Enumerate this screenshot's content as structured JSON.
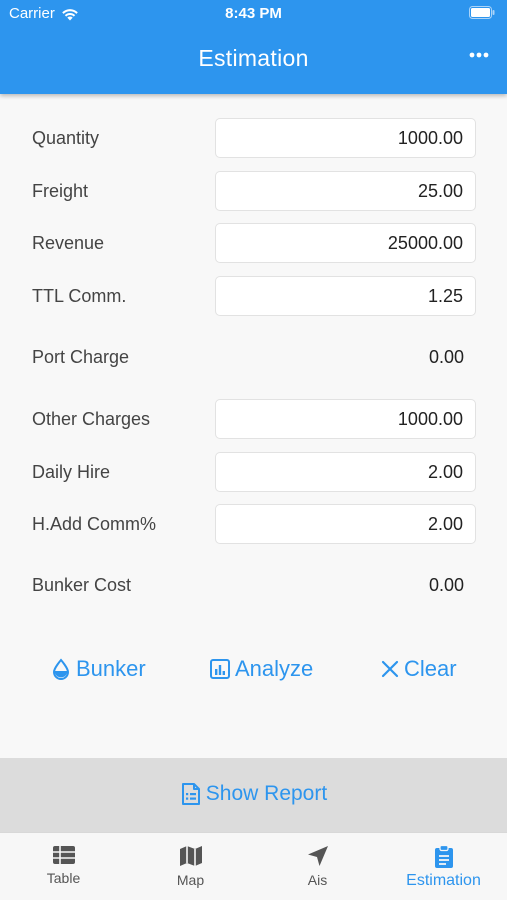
{
  "status_bar": {
    "carrier": "Carrier",
    "time": "8:43 PM"
  },
  "nav": {
    "title": "Estimation",
    "more_icon": "more-horizontal-icon"
  },
  "form": {
    "quantity": {
      "label": "Quantity",
      "value": "1000.00"
    },
    "freight": {
      "label": "Freight",
      "value": "25.00"
    },
    "revenue": {
      "label": "Revenue",
      "value": "25000.00"
    },
    "ttl_comm": {
      "label": "TTL Comm.",
      "value": "1.25"
    },
    "port_charge": {
      "label": "Port Charge",
      "value": "0.00"
    },
    "other_charges": {
      "label": "Other Charges",
      "value": "1000.00"
    },
    "daily_hire": {
      "label": "Daily Hire",
      "value": "2.00"
    },
    "h_add_comm": {
      "label": "H.Add Comm%",
      "value": "2.00"
    },
    "bunker_cost": {
      "label": "Bunker Cost",
      "value": "0.00"
    }
  },
  "actions": {
    "bunker": "Bunker",
    "analyze": "Analyze",
    "clear": "Clear"
  },
  "report": {
    "label": "Show Report"
  },
  "tabs": [
    {
      "label": "Table",
      "icon": "table-icon"
    },
    {
      "label": "Map",
      "icon": "map-icon"
    },
    {
      "label": "Ais",
      "icon": "navigation-arrow-icon"
    },
    {
      "label": "Estimation",
      "icon": "clipboard-icon"
    }
  ],
  "colors": {
    "accent": "#2d95ee",
    "background": "#f8f8f8",
    "report_bar": "#dcdcdc"
  }
}
